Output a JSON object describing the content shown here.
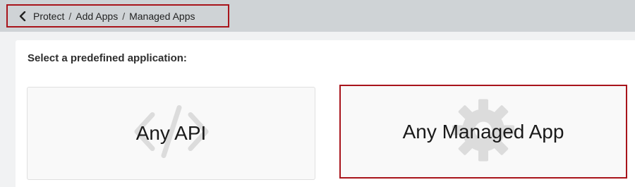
{
  "breadcrumb": {
    "back_icon": "chevron-left-icon",
    "items": [
      "Protect",
      "Add Apps",
      "Managed Apps"
    ],
    "separator": "/"
  },
  "section": {
    "title": "Select a predefined application:"
  },
  "cards": [
    {
      "label": "Any API",
      "icon": "code-brackets-icon"
    },
    {
      "label": "Any Managed App",
      "icon": "gear-icon"
    }
  ],
  "colors": {
    "highlight": "#a8141b",
    "header_bg": "#cfd3d6",
    "card_bg": "#f9f9f9",
    "icon_watermark": "#dcdcdc"
  }
}
